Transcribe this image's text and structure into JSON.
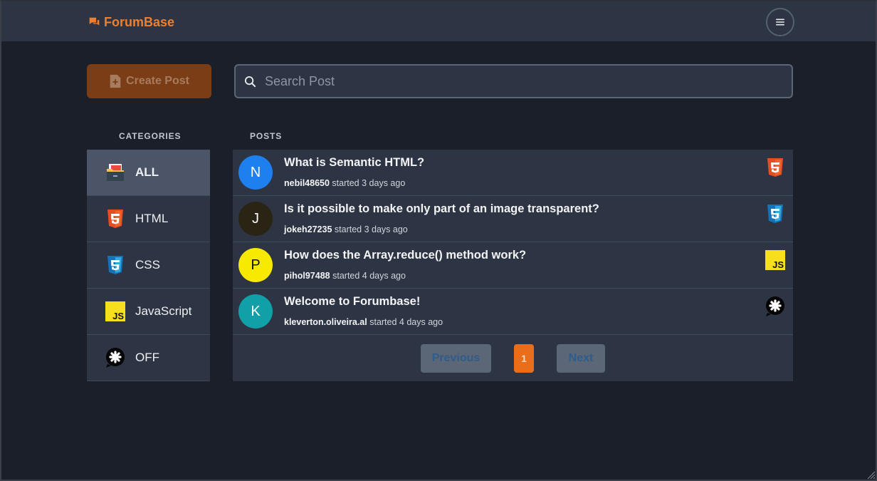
{
  "header": {
    "brand": "ForumBase",
    "brand_color": "#f07f2d",
    "brand_icon": "chat-bubbles-icon",
    "menu_icon": "hamburger-icon"
  },
  "toolbar": {
    "create_label": "Create Post",
    "search_placeholder": "Search Post",
    "search_value": ""
  },
  "sidebar": {
    "title": "CATEGORIES",
    "items": [
      {
        "label": "ALL",
        "icon": "file-cabinet-icon",
        "active": true
      },
      {
        "label": "HTML",
        "icon": "html5-icon",
        "active": false
      },
      {
        "label": "CSS",
        "icon": "css3-icon",
        "active": false
      },
      {
        "label": "JavaScript",
        "icon": "js-icon",
        "active": false
      },
      {
        "label": "OFF",
        "icon": "off-topic-icon",
        "active": false
      }
    ]
  },
  "posts": {
    "title": "POSTS",
    "items": [
      {
        "avatar_letter": "N",
        "avatar_color": "#1e80ef",
        "avatar_text_color": "#ffffff",
        "title": "What is Semantic HTML?",
        "author": "nebil48650",
        "meta": "started 3 days ago",
        "category": "html5-icon"
      },
      {
        "avatar_letter": "J",
        "avatar_color": "#2a2414",
        "avatar_text_color": "#ffffff",
        "title": "Is it possible to make only part of an image transparent?",
        "author": "jokeh27235",
        "meta": "started 3 days ago",
        "category": "css3-icon"
      },
      {
        "avatar_letter": "P",
        "avatar_color": "#f7ea00",
        "avatar_text_color": "#111111",
        "title": "How does the Array.reduce() method work?",
        "author": "pihol97488",
        "meta": "started 4 days ago",
        "category": "js-icon"
      },
      {
        "avatar_letter": "K",
        "avatar_color": "#11a0a8",
        "avatar_text_color": "#ffffff",
        "title": "Welcome to Forumbase!",
        "author": "kleverton.oliveira.al",
        "meta": "started 4 days ago",
        "category": "off-topic-icon"
      }
    ]
  },
  "pagination": {
    "previous": "Previous",
    "current": "1",
    "next": "Next",
    "accent": "#ea6e1a"
  }
}
